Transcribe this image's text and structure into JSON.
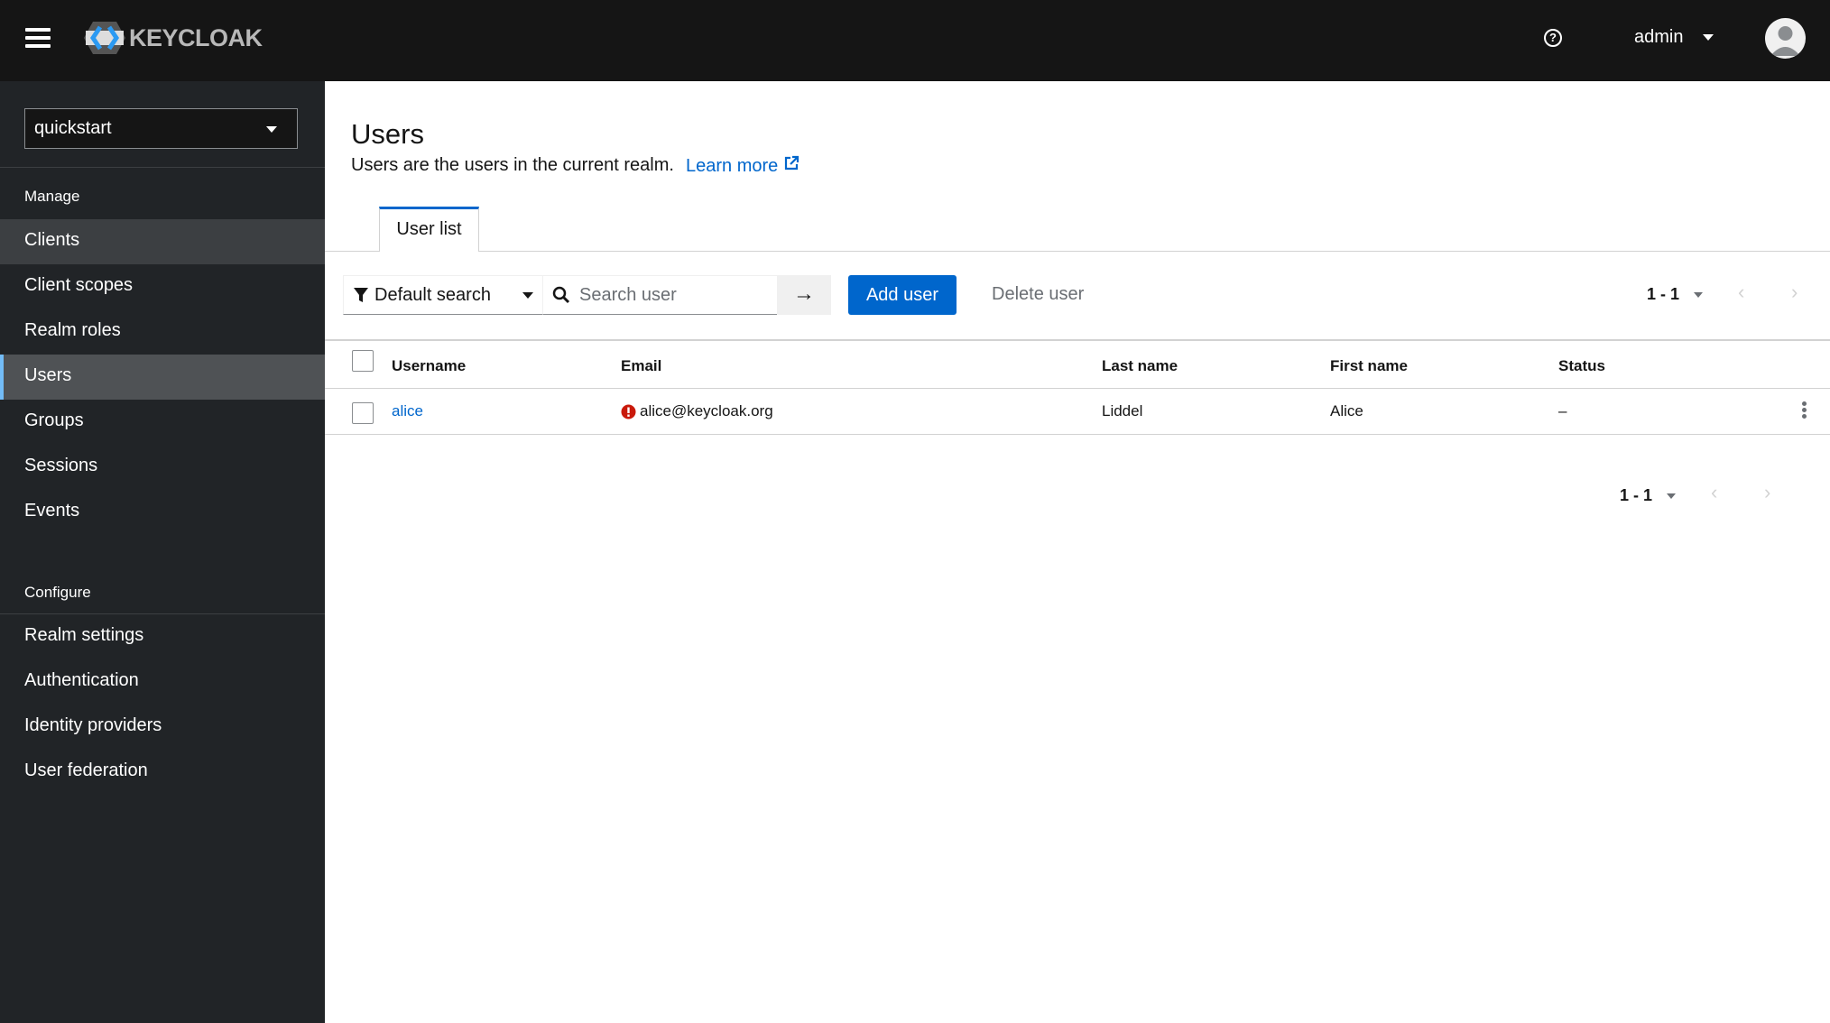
{
  "header": {
    "brand": "KEYCLOAK",
    "user": "admin"
  },
  "sidebar": {
    "realm": "quickstart",
    "manage_label": "Manage",
    "manage_items": [
      {
        "label": "Clients"
      },
      {
        "label": "Client scopes"
      },
      {
        "label": "Realm roles"
      },
      {
        "label": "Users"
      },
      {
        "label": "Groups"
      },
      {
        "label": "Sessions"
      },
      {
        "label": "Events"
      }
    ],
    "configure_label": "Configure",
    "configure_items": [
      {
        "label": "Realm settings"
      },
      {
        "label": "Authentication"
      },
      {
        "label": "Identity providers"
      },
      {
        "label": "User federation"
      }
    ],
    "active": "Users"
  },
  "page": {
    "title": "Users",
    "description": "Users are the users in the current realm.",
    "learn_more": "Learn more",
    "tabs": [
      {
        "label": "User list"
      }
    ]
  },
  "toolbar": {
    "filter": "Default search",
    "search_placeholder": "Search user",
    "add_user": "Add user",
    "delete_user": "Delete user",
    "pagination": "1 - 1"
  },
  "table": {
    "columns": [
      "Username",
      "Email",
      "Last name",
      "First name",
      "Status"
    ],
    "rows": [
      {
        "username": "alice",
        "email": "alice@keycloak.org",
        "email_unverified": true,
        "last_name": "Liddel",
        "first_name": "Alice",
        "status": "–"
      }
    ]
  },
  "footer_pagination": "1 - 1",
  "colors": {
    "accent": "#0066cc",
    "header": "#151515",
    "sidebar": "#212427",
    "warning": "#c9190b"
  }
}
